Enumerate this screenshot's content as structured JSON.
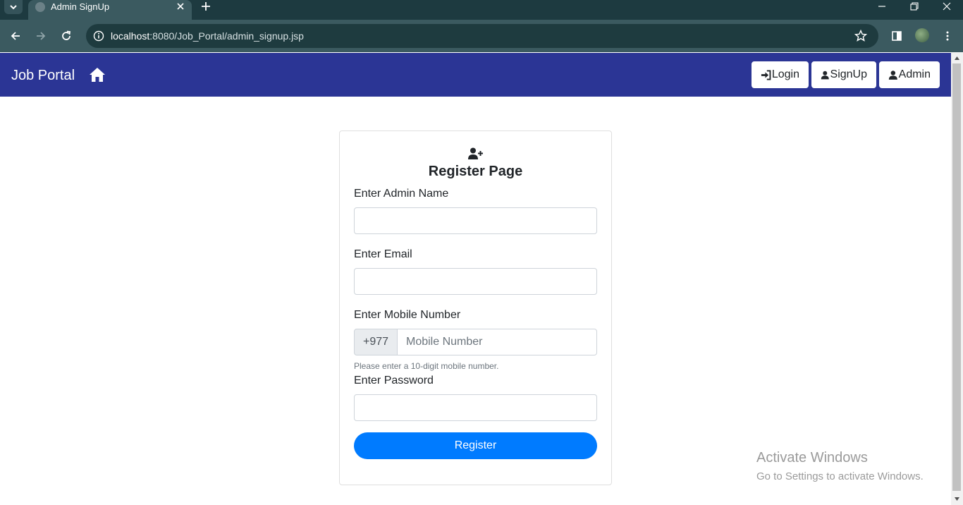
{
  "browser": {
    "tab_title": "Admin SignUp",
    "url_host": "localhost",
    "url_path": ":8080/Job_Portal/admin_signup.jsp"
  },
  "navbar": {
    "brand": "Job Portal",
    "login_label": "Login",
    "signup_label": "SignUp",
    "admin_label": "Admin",
    "background": "#2b3595"
  },
  "form": {
    "title": "Register Page",
    "name_label": "Enter Admin Name",
    "name_value": "",
    "email_label": "Enter Email",
    "email_value": "",
    "mobile_label": "Enter Mobile Number",
    "mobile_prefix": "+977",
    "mobile_placeholder": "Mobile Number",
    "mobile_help": "Please enter a 10-digit mobile number.",
    "password_label": "Enter Password",
    "password_value": "",
    "submit_label": "Register",
    "accent": "#007bff"
  },
  "watermark": {
    "line1": "Activate Windows",
    "line2": "Go to Settings to activate Windows."
  }
}
